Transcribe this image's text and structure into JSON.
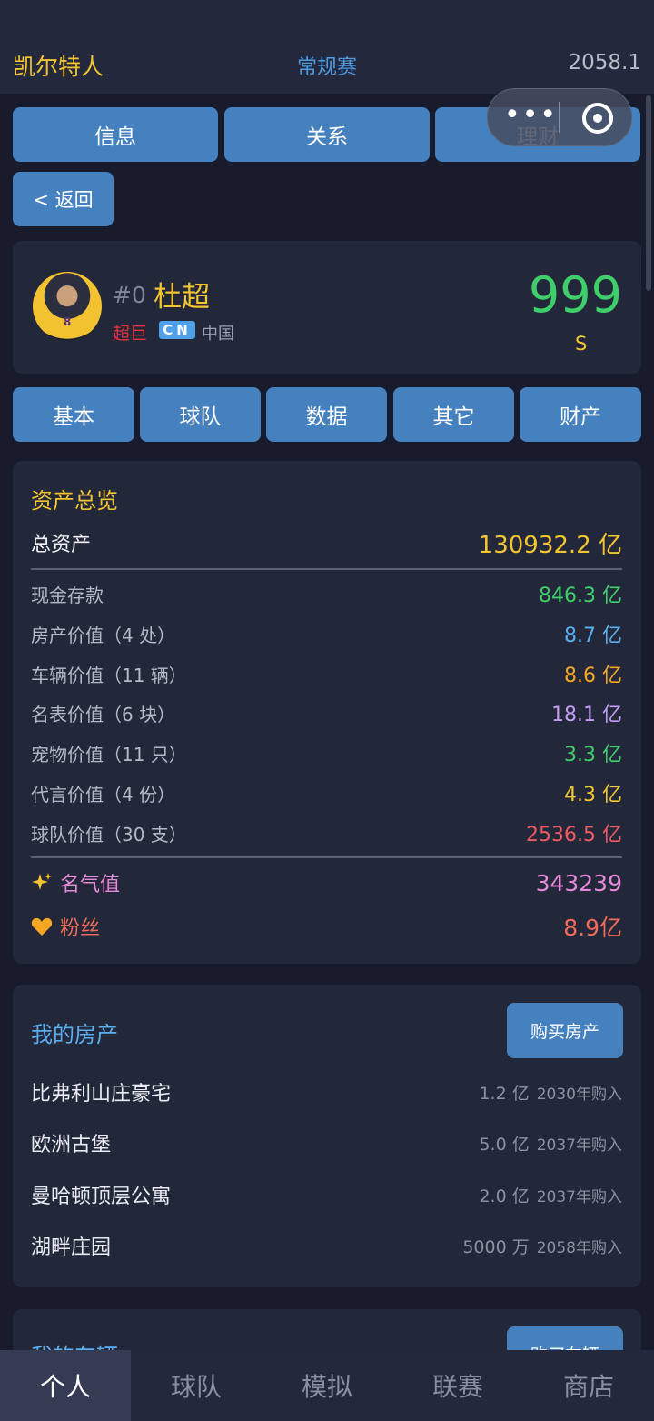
{
  "topbar": {
    "team": "凯尔特人",
    "season": "常规赛",
    "year": "2058.1"
  },
  "capsule": {
    "dots": "•••"
  },
  "tabs": [
    {
      "label": "信息"
    },
    {
      "label": "关系"
    },
    {
      "label": "理财"
    }
  ],
  "back_label": "< 返回",
  "player": {
    "number": "#0",
    "name": "杜超",
    "tier": "超巨",
    "flag_text": "CN",
    "country": "中国",
    "rating": "999",
    "grade": "S",
    "jersey_number": "8"
  },
  "subtabs": [
    {
      "label": "基本"
    },
    {
      "label": "球队"
    },
    {
      "label": "数据"
    },
    {
      "label": "其它"
    },
    {
      "label": "财产"
    }
  ],
  "assets": {
    "title": "资产总览",
    "total_label": "总资产",
    "total_value": "130932.2 亿",
    "items": [
      {
        "label": "现金存款",
        "value": "846.3 亿",
        "color": "#3ecf6b"
      },
      {
        "label": "房产价值（4 处）",
        "value": "8.7 亿",
        "color": "#5aaef0"
      },
      {
        "label": "车辆价值（11 辆）",
        "value": "8.6 亿",
        "color": "#f5a623"
      },
      {
        "label": "名表价值（6 块）",
        "value": "18.1 亿",
        "color": "#c49cf3"
      },
      {
        "label": "宠物价值（11 只）",
        "value": "3.3 亿",
        "color": "#3ecf6b"
      },
      {
        "label": "代言价值（4 份）",
        "value": "4.3 亿",
        "color": "#f3c530"
      },
      {
        "label": "球队价值（30 支）",
        "value": "2536.5 亿",
        "color": "#ef5a63"
      }
    ],
    "fame": {
      "icon": "sparkles-icon",
      "label": "名气值",
      "value": "343239"
    },
    "fans": {
      "icon": "heart-icon",
      "label": "粉丝",
      "value": "8.9亿"
    }
  },
  "houses": {
    "title": "我的房产",
    "buy_label": "购买房产",
    "items": [
      {
        "name": "比弗利山庄豪宅",
        "value": "1.2 亿",
        "year": "2030年购入"
      },
      {
        "name": "欧洲古堡",
        "value": "5.0 亿",
        "year": "2037年购入"
      },
      {
        "name": "曼哈顿顶层公寓",
        "value": "2.0 亿",
        "year": "2037年购入"
      },
      {
        "name": "湖畔庄园",
        "value": "5000 万",
        "year": "2058年购入"
      }
    ]
  },
  "vehicles": {
    "title": "我的车辆",
    "buy_label": "购买车辆"
  },
  "bottom_nav": [
    {
      "label": "个人"
    },
    {
      "label": "球队"
    },
    {
      "label": "模拟"
    },
    {
      "label": "联赛"
    },
    {
      "label": "商店"
    }
  ],
  "colors": {
    "accent": "#4681bf",
    "gold": "#f3c530",
    "green": "#3ecf6b",
    "background": "#171b2b"
  }
}
